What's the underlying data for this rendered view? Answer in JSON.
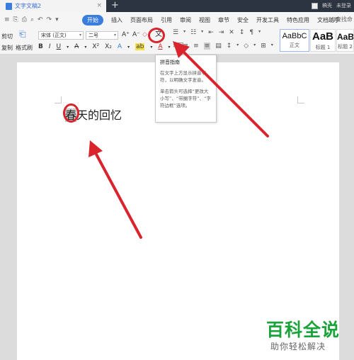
{
  "window": {
    "doc_tab_title": "文字文稿2",
    "tab_close_glyph": "×",
    "new_tab_glyph": "+",
    "right_items": [
      "稿壳",
      "未登录"
    ]
  },
  "quick_access": [
    "≡",
    "⎘",
    "⎙",
    "⌕",
    "↶",
    "↷",
    "▾"
  ],
  "menu": {
    "items": [
      "开始",
      "插入",
      "页面布局",
      "引用",
      "审阅",
      "视图",
      "章节",
      "安全",
      "开发工具",
      "特色应用",
      "文档助手"
    ],
    "active_index": 0,
    "search_label": "Q查找命"
  },
  "ribbon": {
    "cut_label": "剪切",
    "copy_label": "复制",
    "format_painter_label": "格式刷",
    "font_name": "宋体 (正文)",
    "font_size": "二号",
    "grow_font": "A⁺",
    "shrink_font": "A⁻",
    "clear_format": "◇",
    "pinyin_glyph": "文",
    "format_buttons": [
      "B",
      "I",
      "U",
      "▾",
      "A",
      "▾",
      "X²",
      "X₂",
      "A",
      "▾",
      "ab",
      "▾",
      "A",
      "▾",
      "A"
    ],
    "para_row1": [
      "☰",
      "▾",
      "☷",
      "▾",
      "⇤",
      "⇥",
      "✕",
      "↕",
      "¶",
      "▾"
    ],
    "para_row2": [
      "≡",
      "≡",
      "≡",
      "≡",
      "▤",
      "↕",
      "▾",
      "◇",
      "▾",
      "⊞",
      "▾"
    ],
    "styles": [
      {
        "sample": "AaBbC",
        "name": "正文"
      },
      {
        "sample": "AaB",
        "name": "标题 1"
      },
      {
        "sample": "AaBl",
        "name": "标题 2"
      }
    ]
  },
  "document": {
    "first_char": "春",
    "rest_text": "天的回忆"
  },
  "tooltip": {
    "title": "拼音指南",
    "line1": "在文字上方显示拼音字符，以明确文字发音。",
    "line2": "单击箭头可选择“更改大小写”、“带圈字符”、“字符边框”选项。"
  },
  "colors": {
    "accent": "#3b7ddd",
    "annotation_red": "#d9232d",
    "watermark_green": "#1aa33b"
  },
  "watermark": {
    "logo": "百科全说",
    "tagline": "助你轻松解决"
  }
}
